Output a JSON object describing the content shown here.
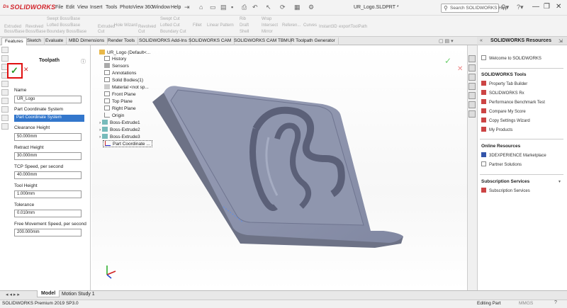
{
  "app": {
    "logo": "SOLIDWORKS",
    "doc_title": "UR_Logo.SLDPRT *"
  },
  "menu": [
    "File",
    "Edit",
    "View",
    "Insert",
    "Tools",
    "PhotoView 360",
    "Window",
    "Help"
  ],
  "search": {
    "placeholder": "Search SOLIDWORKS Help"
  },
  "commands": {
    "extruded_boss": "Extruded\nBoss/Base",
    "revolved_boss": "Revolved\nBoss/Base",
    "swept_boss": "Swept Boss/Base",
    "lofted_boss": "Lofted Boss/Base",
    "boundary_boss": "Boundary Boss/Base",
    "extruded_cut": "Extruded\nCut",
    "hole_wizard": "Hole Wizard",
    "revolved_cut": "Revolved\nCut",
    "swept_cut": "Swept Cut",
    "lofted_cut": "Lofted Cut",
    "boundary_cut": "Boundary Cut",
    "fillet": "Fillet",
    "linear_pattern": "Linear Pattern",
    "rib": "Rib",
    "draft": "Draft",
    "shell": "Shell",
    "wrap": "Wrap",
    "intersect": "Intersect",
    "mirror": "Mirror",
    "reference": "Referen...",
    "curves": "Curves",
    "instant3d": "Instant3D",
    "export_toolpath": "exportToolPath"
  },
  "tabs": [
    "Features",
    "Sketch",
    "Evaluate",
    "MBD Dimensions",
    "Render Tools",
    "SOLIDWORKS Add-Ins",
    "SOLIDWORKS CAM",
    "SOLIDWORKS CAM TBM",
    "UR Toolpath Generator"
  ],
  "property_manager": {
    "title": "Toolpath",
    "fields": [
      {
        "label": "Name",
        "value": "UR_Logo"
      },
      {
        "label": "Part Coordinate System",
        "value": "Part Coordinate System"
      },
      {
        "label": "Clearance Height",
        "value": "50.000mm"
      },
      {
        "label": "Retract Height",
        "value": "30.000mm"
      },
      {
        "label": "TCP Speed, per second",
        "value": "40.000mm"
      },
      {
        "label": "Tool Height",
        "value": "1.000mm"
      },
      {
        "label": "Tolerance",
        "value": "0.010mm"
      },
      {
        "label": "Free Movement Speed, per second",
        "value": "200.000mm"
      }
    ]
  },
  "feature_tree": [
    "UR_Logo (Default<...",
    "History",
    "Sensors",
    "Annotations",
    "Solid Bodies(1)",
    "Material <not sp...",
    "Front Plane",
    "Top Plane",
    "Right Plane",
    "Origin",
    "Boss-Extrude1",
    "Boss-Extrude2",
    "Boss-Extrude3",
    "Part Coordinate ..."
  ],
  "resources": {
    "header": "SOLIDWORKS Resources",
    "welcome": "Welcome to SOLIDWORKS",
    "tools_title": "SOLIDWORKS Tools",
    "tools": [
      "Property Tab Builder",
      "SOLIDWORKS Rx",
      "Performance Benchmark Test",
      "Compare My Score",
      "Copy Settings Wizard",
      "My Products"
    ],
    "online_title": "Online Resources",
    "online": [
      "3DEXPERIENCE Marketplace",
      "Partner Solutions"
    ],
    "subscription_title": "Subscription Services",
    "subscription": [
      "Subscription Services"
    ]
  },
  "bottom_tabs": [
    "Model",
    "Motion Study 1"
  ],
  "status": {
    "left": "SOLIDWORKS Premium 2019 SP3.0",
    "mode": "Editing Part",
    "units": "MMGS"
  },
  "colors": {
    "accent": "#3377cc",
    "ok": "#2a9a2a",
    "cancel": "#d03030",
    "highlight_box": "#e01010",
    "model": "#8a8fa8"
  }
}
